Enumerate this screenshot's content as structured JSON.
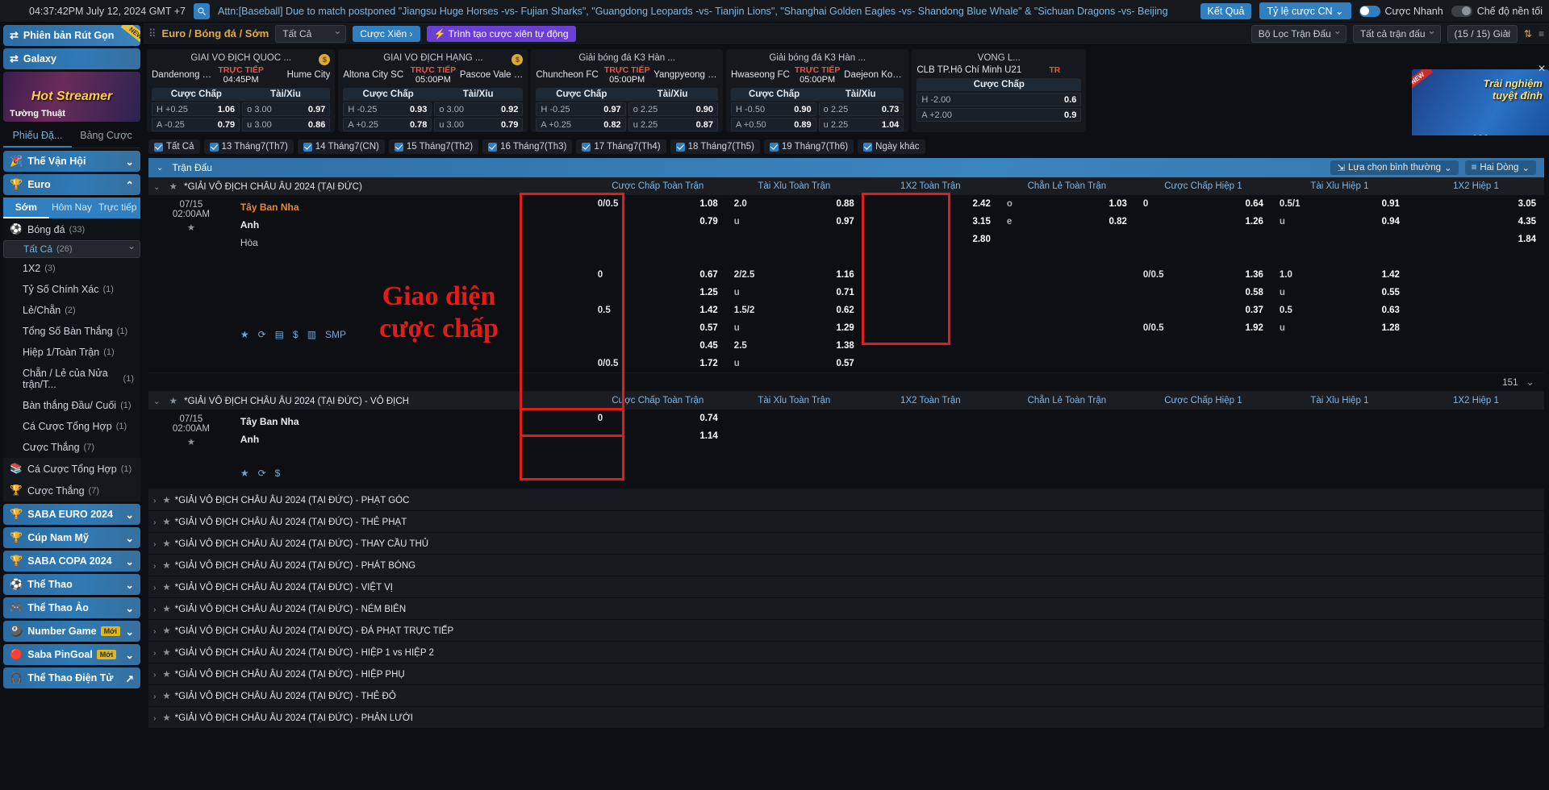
{
  "topbar": {
    "clock": "04:37:42PM July 12, 2024 GMT +7",
    "marquee": "Attn:[Baseball] Due to match postponed \"Jiangsu Huge Horses -vs- Fujian Sharks\", \"Guangdong Leopards -vs- Tianjin Lions\", \"Shanghai Golden Eagles -vs- Shandong Blue Whale\" & \"Sichuan Dragons -vs- Beijing",
    "results_btn": "Kết Quả",
    "odds_select": "Tỷ lệ cược CN",
    "quick_bet": "Cược Nhanh",
    "dark_mode": "Chế độ nền tối"
  },
  "sidebar": {
    "compact_version": "Phiên bản Rút Gọn",
    "galaxy": "Galaxy",
    "banner_title": "Hot Streamer",
    "banner_sub": "Tường Thuật",
    "tabs": [
      {
        "label": "Phiếu Đặ...",
        "active": true
      },
      {
        "label": "Bảng Cược",
        "active": false
      }
    ],
    "pills_top": [
      {
        "label": "Thế Vận Hội",
        "icon": "🎉",
        "expanded": false
      },
      {
        "label": "Euro",
        "icon": "🏆",
        "expanded": true
      }
    ],
    "euro_tabs": [
      {
        "label": "Sớm",
        "active": true
      },
      {
        "label": "Hôm Nay",
        "active": false
      },
      {
        "label": "Trực tiếp",
        "active": false
      }
    ],
    "sport_header": {
      "label": "Bóng đá",
      "count": "(33)",
      "icon": "⚽"
    },
    "markets": [
      {
        "label": "Tất Cả",
        "count": "(26)",
        "selected": true
      },
      {
        "label": "1X2",
        "count": "(3)",
        "selected": false
      },
      {
        "label": "Tỷ Số Chính Xác",
        "count": "(1)",
        "selected": false
      },
      {
        "label": "Lẻ/Chẵn",
        "count": "(2)",
        "selected": false
      },
      {
        "label": "Tổng Số Bàn Thắng",
        "count": "(1)",
        "selected": false
      },
      {
        "label": "Hiệp 1/Toàn Trận",
        "count": "(1)",
        "selected": false
      },
      {
        "label": "Chẵn / Lẻ của Nửa trận/T...",
        "count": "(1)",
        "selected": false
      },
      {
        "label": "Bàn thắng Đầu/ Cuối",
        "count": "(1)",
        "selected": false
      },
      {
        "label": "Cá Cược Tổng Hợp",
        "count": "(1)",
        "selected": false
      },
      {
        "label": "Cược Thắng",
        "count": "(7)",
        "selected": false
      }
    ],
    "extra_rows": [
      {
        "label": "Cá Cược Tổng Hợp",
        "count": "(1)",
        "icon": "📚"
      },
      {
        "label": "Cược Thắng",
        "count": "(7)",
        "icon": "🏆"
      }
    ],
    "pills_bottom": [
      {
        "label": "SABA EURO 2024",
        "icon": "🏆",
        "badge": ""
      },
      {
        "label": "Cúp Nam Mỹ",
        "icon": "🏆",
        "badge": ""
      },
      {
        "label": "SABA COPA 2024",
        "icon": "🏆",
        "badge": ""
      },
      {
        "label": "Thể Thao",
        "icon": "⚽",
        "badge": ""
      },
      {
        "label": "Thể Thao Ảo",
        "icon": "🎮",
        "badge": ""
      },
      {
        "label": "Number Game",
        "icon": "🎱",
        "badge": "Mới"
      },
      {
        "label": "Saba PinGoal",
        "icon": "🔴",
        "badge": "Mới"
      },
      {
        "label": "Thể Thao Điện Tử",
        "icon": "🎧",
        "badge": "",
        "external": "↗"
      }
    ]
  },
  "mainheader": {
    "breadcrumb": "Euro / Bóng đá / Sớm",
    "all_select": "Tất Cả",
    "parlay_btn": "Cược Xiên",
    "auto_parlay_btn": "Trình tạo cược xiên tự động",
    "filter_select": "Bộ Lọc Trận Đấu",
    "all_matches_select": "Tất cả trận đấu",
    "leagues_count": "(15 / 15) Giải"
  },
  "promo": {
    "new_tag": "NEW",
    "line1": "Trải nghiệm",
    "line2": "tuyệt đỉnh"
  },
  "match_cards": [
    {
      "league": "GIẢI VÔ ĐỊCH QUỐC ...",
      "home": "Dandenong City SC",
      "away": "Hume City",
      "live": "TRỰC TIẾP",
      "time": "04:45PM",
      "coin": "$",
      "col1": "Cược Chấp",
      "col2": "Tài/Xỉu",
      "rows": [
        {
          "k1": "H +0.25",
          "v1": "1.06",
          "k2": "o 3.00",
          "v2": "0.97"
        },
        {
          "k1": "A -0.25",
          "v1": "0.79",
          "k2": "u 3.00",
          "v2": "0.86"
        }
      ]
    },
    {
      "league": "GIẢI VÔ ĐỊCH HẠNG ...",
      "home": "Altona City SC",
      "away": "Pascoe Vale FC",
      "live": "TRỰC TIẾP",
      "time": "05:00PM",
      "coin": "$",
      "col1": "Cược Chấp",
      "col2": "Tài/Xỉu",
      "rows": [
        {
          "k1": "H -0.25",
          "v1": "0.93",
          "k2": "o 3.00",
          "v2": "0.92"
        },
        {
          "k1": "A +0.25",
          "v1": "0.78",
          "k2": "u 3.00",
          "v2": "0.79"
        }
      ]
    },
    {
      "league": "Giải bóng đá K3 Hàn ...",
      "home": "Chuncheon FC",
      "away": "Yangpyeong FC",
      "live": "TRỰC TIẾP",
      "time": "05:00PM",
      "coin": "",
      "col1": "Cược Chấp",
      "col2": "Tài/Xỉu",
      "rows": [
        {
          "k1": "H -0.25",
          "v1": "0.97",
          "k2": "o 2.25",
          "v2": "0.90"
        },
        {
          "k1": "A +0.25",
          "v1": "0.82",
          "k2": "u 2.25",
          "v2": "0.87"
        }
      ]
    },
    {
      "league": "Giải bóng đá K3 Hàn ...",
      "home": "Hwaseong FC",
      "away": "Daejeon Korail",
      "live": "TRỰC TIẾP",
      "time": "05:00PM",
      "coin": "",
      "col1": "Cược Chấp",
      "col2": "Tài/Xỉu",
      "rows": [
        {
          "k1": "H -0.50",
          "v1": "0.90",
          "k2": "o 2.25",
          "v2": "0.73"
        },
        {
          "k1": "A +0.50",
          "v1": "0.89",
          "k2": "u 2.25",
          "v2": "1.04"
        }
      ]
    },
    {
      "league": "VÒNG L...",
      "home": "CLB TP.Hồ Chí Minh U21",
      "away": "",
      "live": "TR",
      "time": "",
      "coin": "",
      "col1": "Cược Chấp",
      "col2": "",
      "rows": [
        {
          "k1": "H -2.00",
          "v1": "0.6",
          "k2": "",
          "v2": ""
        },
        {
          "k1": "A +2.00",
          "v1": "0.9",
          "k2": "",
          "v2": ""
        }
      ]
    }
  ],
  "date_filters": [
    {
      "label": "Tất Cả",
      "checked": true
    },
    {
      "label": "13 Tháng7(Th7)",
      "checked": true
    },
    {
      "label": "14 Tháng7(CN)",
      "checked": true
    },
    {
      "label": "15 Tháng7(Th2)",
      "checked": true
    },
    {
      "label": "16 Tháng7(Th3)",
      "checked": true
    },
    {
      "label": "17 Tháng7(Th4)",
      "checked": true
    },
    {
      "label": "18 Tháng7(Th5)",
      "checked": true
    },
    {
      "label": "19 Tháng7(Th6)",
      "checked": true
    },
    {
      "label": "Ngày khác",
      "checked": true
    }
  ],
  "table_toolbar": {
    "title": "Trận Đấu",
    "view_select": "Lựa chọn bình thường",
    "rows_select": "Hai Dòng"
  },
  "columns": [
    "Cược Chấp Toàn Trận",
    "Tài Xỉu Toàn Trận",
    "1X2 Toàn Trận",
    "Chẵn Lẻ Toàn Trận",
    "Cược Chấp Hiệp 1",
    "Tài Xỉu Hiệp 1",
    "1X2 Hiệp 1"
  ],
  "league_group": {
    "name": "*GIẢI VÔ ĐỊCH CHÂU ÂU 2024 (TẠI ĐỨC)",
    "count_pill": "151"
  },
  "match": {
    "date": "07/15",
    "time": "02:00AM",
    "home": "Tây Ban Nha",
    "away": "Anh",
    "draw": "Hòa",
    "icons": [
      "★",
      "⟳",
      "▤",
      "$",
      "▥",
      "SMP"
    ],
    "blocks": [
      {
        "hdp_full": [
          {
            "k": "0/0.5",
            "v": "1.08"
          },
          {
            "k": "",
            "v": "0.79"
          },
          {
            "k": "",
            "v": ""
          }
        ],
        "ou_full": [
          {
            "k": "2.0",
            "v": "0.88"
          },
          {
            "k": "u",
            "v": "0.97"
          },
          {
            "k": "",
            "v": ""
          }
        ],
        "x12_full": [
          {
            "k": "",
            "v": "2.42"
          },
          {
            "k": "",
            "v": "3.15"
          },
          {
            "k": "",
            "v": "2.80"
          }
        ],
        "oe_full": [
          {
            "k": "o",
            "v": "1.03"
          },
          {
            "k": "e",
            "v": "0.82"
          },
          {
            "k": "",
            "v": ""
          }
        ],
        "hdp_h1": [
          {
            "k": "0",
            "v": "0.64"
          },
          {
            "k": "",
            "v": "1.26"
          },
          {
            "k": "",
            "v": ""
          }
        ],
        "ou_h1": [
          {
            "k": "0.5/1",
            "v": "0.91"
          },
          {
            "k": "u",
            "v": "0.94"
          },
          {
            "k": "",
            "v": ""
          }
        ],
        "x12_h1": [
          {
            "k": "",
            "v": "3.05"
          },
          {
            "k": "",
            "v": "4.35"
          },
          {
            "k": "",
            "v": "1.84"
          }
        ]
      },
      {
        "hdp_full": [
          {
            "k": "0",
            "v": "0.67"
          },
          {
            "k": "",
            "v": "1.25"
          },
          {
            "k": "",
            "v": ""
          }
        ],
        "ou_full": [
          {
            "k": "2/2.5",
            "v": "1.16"
          },
          {
            "k": "u",
            "v": "0.71"
          },
          {
            "k": "",
            "v": ""
          }
        ],
        "x12_full": [
          {
            "k": "",
            "v": ""
          },
          {
            "k": "",
            "v": ""
          },
          {
            "k": "",
            "v": ""
          }
        ],
        "oe_full": [
          {
            "k": "",
            "v": ""
          },
          {
            "k": "",
            "v": ""
          },
          {
            "k": "",
            "v": ""
          }
        ],
        "hdp_h1": [
          {
            "k": "0/0.5",
            "v": "1.36"
          },
          {
            "k": "",
            "v": "0.58"
          },
          {
            "k": "",
            "v": ""
          }
        ],
        "ou_h1": [
          {
            "k": "1.0",
            "v": "1.42"
          },
          {
            "k": "u",
            "v": "0.55"
          },
          {
            "k": "",
            "v": ""
          }
        ],
        "x12_h1": [
          {
            "k": "",
            "v": ""
          },
          {
            "k": "",
            "v": ""
          },
          {
            "k": "",
            "v": ""
          }
        ]
      },
      {
        "hdp_full": [
          {
            "k": "0.5",
            "v": "1.42"
          },
          {
            "k": "",
            "v": "0.57"
          },
          {
            "k": "",
            "v": ""
          }
        ],
        "ou_full": [
          {
            "k": "1.5/2",
            "v": "0.62"
          },
          {
            "k": "u",
            "v": "1.29"
          },
          {
            "k": "",
            "v": ""
          }
        ],
        "x12_full": [
          {
            "k": "",
            "v": ""
          },
          {
            "k": "",
            "v": ""
          },
          {
            "k": "",
            "v": ""
          }
        ],
        "oe_full": [
          {
            "k": "",
            "v": ""
          },
          {
            "k": "",
            "v": ""
          },
          {
            "k": "",
            "v": ""
          }
        ],
        "hdp_h1": [
          {
            "k": "",
            "v": "0.37"
          },
          {
            "k": "0/0.5",
            "v": "1.92"
          },
          {
            "k": "",
            "v": ""
          }
        ],
        "ou_h1": [
          {
            "k": "0.5",
            "v": "0.63"
          },
          {
            "k": "u",
            "v": "1.28"
          },
          {
            "k": "",
            "v": ""
          }
        ],
        "x12_h1": [
          {
            "k": "",
            "v": ""
          },
          {
            "k": "",
            "v": ""
          },
          {
            "k": "",
            "v": ""
          }
        ]
      },
      {
        "hdp_full": [
          {
            "k": "",
            "v": "0.45"
          },
          {
            "k": "0/0.5",
            "v": "1.72"
          },
          {
            "k": "",
            "v": ""
          }
        ],
        "ou_full": [
          {
            "k": "2.5",
            "v": "1.38"
          },
          {
            "k": "u",
            "v": "0.57"
          },
          {
            "k": "",
            "v": ""
          }
        ],
        "x12_full": [
          {
            "k": "",
            "v": ""
          },
          {
            "k": "",
            "v": ""
          },
          {
            "k": "",
            "v": ""
          }
        ],
        "oe_full": [
          {
            "k": "",
            "v": ""
          },
          {
            "k": "",
            "v": ""
          },
          {
            "k": "",
            "v": ""
          }
        ],
        "hdp_h1": [
          {
            "k": "",
            "v": ""
          },
          {
            "k": "",
            "v": ""
          },
          {
            "k": "",
            "v": ""
          }
        ],
        "ou_h1": [
          {
            "k": "",
            "v": ""
          },
          {
            "k": "",
            "v": ""
          },
          {
            "k": "",
            "v": ""
          }
        ],
        "x12_h1": [
          {
            "k": "",
            "v": ""
          },
          {
            "k": "",
            "v": ""
          },
          {
            "k": "",
            "v": ""
          }
        ]
      }
    ]
  },
  "league_group2": {
    "name": "*GIẢI VÔ ĐỊCH CHÂU ÂU 2024 (TẠI ĐỨC) - VÔ ĐỊCH",
    "date": "07/15",
    "time": "02:00AM",
    "home": "Tây Ban Nha",
    "away": "Anh",
    "odds": [
      {
        "k": "0",
        "v": "0.74"
      },
      {
        "k": "",
        "v": "1.14"
      }
    ],
    "icons": [
      "★",
      "⟳",
      "$"
    ]
  },
  "accordions": [
    "*GIẢI VÔ ĐỊCH CHÂU ÂU 2024 (TẠI ĐỨC) - PHẠT GÓC",
    "*GIẢI VÔ ĐỊCH CHÂU ÂU 2024 (TẠI ĐỨC) - THẺ PHẠT",
    "*GIẢI VÔ ĐỊCH CHÂU ÂU 2024 (TẠI ĐỨC) - THAY CẦU THỦ",
    "*GIẢI VÔ ĐỊCH CHÂU ÂU 2024 (TẠI ĐỨC) - PHÁT BÓNG",
    "*GIẢI VÔ ĐỊCH CHÂU ÂU 2024 (TẠI ĐỨC) - VIỆT VỊ",
    "*GIẢI VÔ ĐỊCH CHÂU ÂU 2024 (TẠI ĐỨC) - NÉM BIÊN",
    "*GIẢI VÔ ĐỊCH CHÂU ÂU 2024 (TẠI ĐỨC) - ĐÁ PHẠT TRỰC TIẾP",
    "*GIẢI VÔ ĐỊCH CHÂU ÂU 2024 (TẠI ĐỨC) - HIỆP 1 vs HIỆP 2",
    "*GIẢI VÔ ĐỊCH CHÂU ÂU 2024 (TẠI ĐỨC) - HIỆP PHỤ",
    "*GIẢI VÔ ĐỊCH CHÂU ÂU 2024 (TẠI ĐỨC) - THẺ ĐỎ",
    "*GIẢI VÔ ĐỊCH CHÂU ÂU 2024 (TẠI ĐỨC) - PHẢN LƯỚI"
  ],
  "annotation": {
    "line1": "Giao diện",
    "line2": "cược chấp",
    "color": "#e21c1c"
  }
}
